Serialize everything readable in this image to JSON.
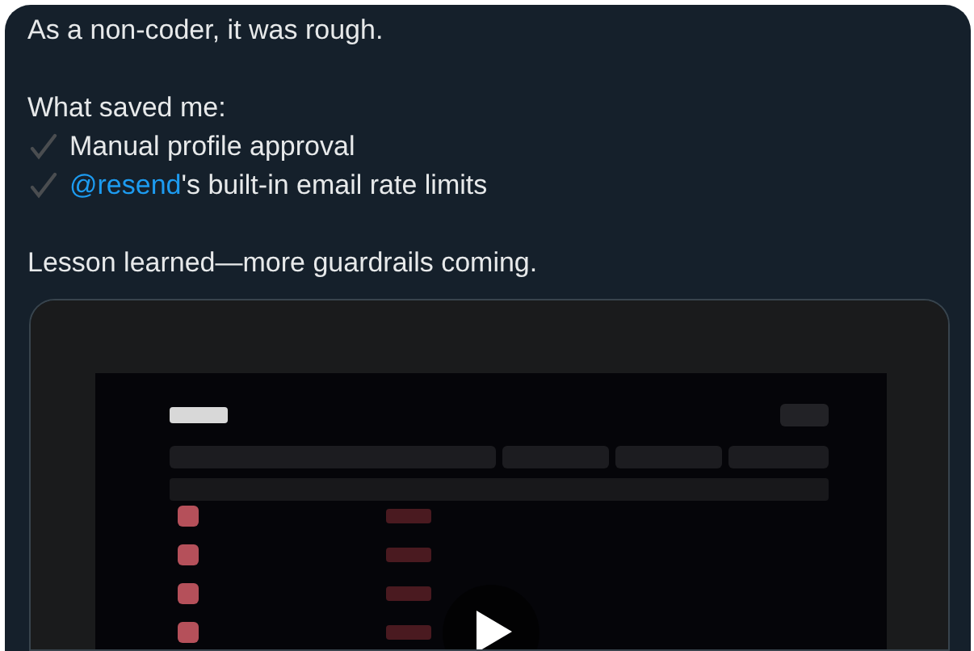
{
  "post": {
    "paragraphs": [
      {
        "lines": [
          {
            "kind": "text",
            "text": "As a non-coder, it was rough."
          }
        ]
      },
      {
        "lines": [
          {
            "kind": "text",
            "text": "What saved me:"
          },
          {
            "kind": "check",
            "text": "Manual profile approval"
          },
          {
            "kind": "check",
            "mention": "@resend",
            "text": "'s built-in email rate limits"
          }
        ]
      },
      {
        "lines": [
          {
            "kind": "text",
            "text": "Lesson learned—more guardrails coming."
          }
        ]
      }
    ]
  }
}
